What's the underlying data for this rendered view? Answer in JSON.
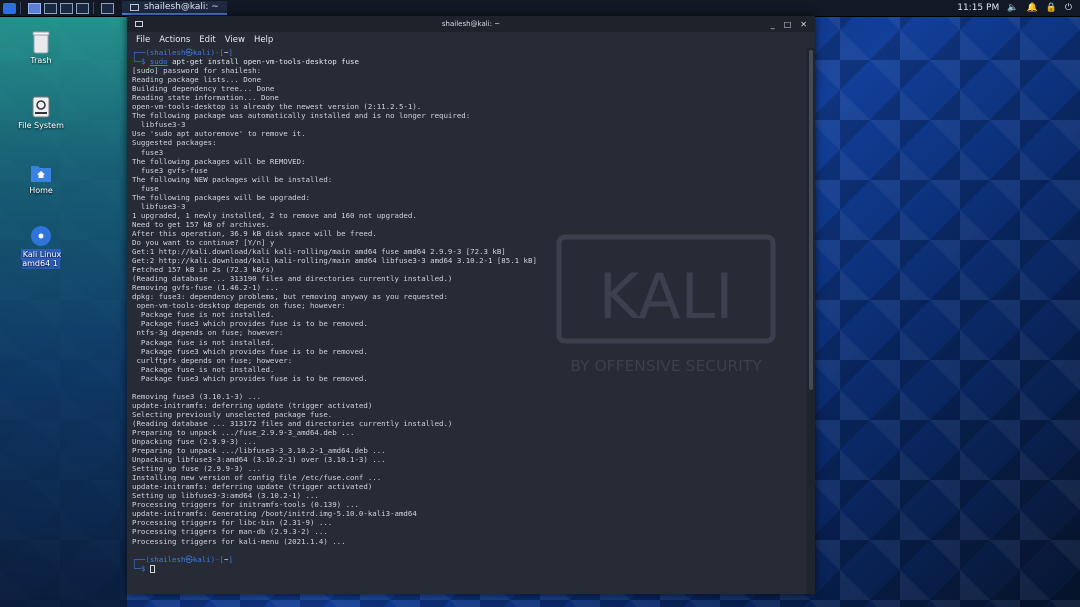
{
  "top_panel": {
    "task_title": "shailesh@kali: ~",
    "time": "11:15 PM"
  },
  "desktop_icons": [
    {
      "label": "Trash"
    },
    {
      "label": "File System"
    },
    {
      "label": "Home"
    },
    {
      "label": "Kali Linux amd64 1"
    }
  ],
  "window": {
    "title": "shailesh@kali: ~",
    "controls": [
      "_",
      "□",
      "✕"
    ],
    "menu": [
      "File",
      "Actions",
      "Edit",
      "View",
      "Help"
    ]
  },
  "terminal": {
    "prompt_user": "shailesh",
    "prompt_host": "kali",
    "prompt_dir": "~",
    "command_sudo": "sudo",
    "command_rest": " apt-get install open-vm-tools-desktop fuse",
    "output": [
      "[sudo] password for shailesh:",
      "Reading package lists... Done",
      "Building dependency tree... Done",
      "Reading state information... Done",
      "open-vm-tools-desktop is already the newest version (2:11.2.5-1).",
      "The following package was automatically installed and is no longer required:",
      "  libfuse3-3",
      "Use 'sudo apt autoremove' to remove it.",
      "Suggested packages:",
      "  fuse3",
      "The following packages will be REMOVED:",
      "  fuse3 gvfs-fuse",
      "The following NEW packages will be installed:",
      "  fuse",
      "The following packages will be upgraded:",
      "  libfuse3-3",
      "1 upgraded, 1 newly installed, 2 to remove and 160 not upgraded.",
      "Need to get 157 kB of archives.",
      "After this operation, 36.9 kB disk space will be freed.",
      "Do you want to continue? [Y/n] y",
      "Get:1 http://kali.download/kali kali-rolling/main amd64 fuse amd64 2.9.9-3 [72.3 kB]",
      "Get:2 http://kali.download/kali kali-rolling/main amd64 libfuse3-3 amd64 3.10.2-1 [85.1 kB]",
      "Fetched 157 kB in 2s (72.3 kB/s)",
      "(Reading database ... 313190 files and directories currently installed.)",
      "Removing gvfs-fuse (1.46.2-1) ...",
      "dpkg: fuse3: dependency problems, but removing anyway as you requested:",
      " open-vm-tools-desktop depends on fuse; however:",
      "  Package fuse is not installed.",
      "  Package fuse3 which provides fuse is to be removed.",
      " ntfs-3g depends on fuse; however:",
      "  Package fuse is not installed.",
      "  Package fuse3 which provides fuse is to be removed.",
      " curlftpfs depends on fuse; however:",
      "  Package fuse is not installed.",
      "  Package fuse3 which provides fuse is to be removed.",
      "",
      "Removing fuse3 (3.10.1-3) ...",
      "update-initramfs: deferring update (trigger activated)",
      "Selecting previously unselected package fuse.",
      "(Reading database ... 313172 files and directories currently installed.)",
      "Preparing to unpack .../fuse_2.9.9-3_amd64.deb ...",
      "Unpacking fuse (2.9.9-3) ...",
      "Preparing to unpack .../libfuse3-3_3.10.2-1_amd64.deb ...",
      "Unpacking libfuse3-3:amd64 (3.10.2-1) over (3.10.1-3) ...",
      "Setting up fuse (2.9.9-3) ...",
      "Installing new version of config file /etc/fuse.conf ...",
      "update-initramfs: deferring update (trigger activated)",
      "Setting up libfuse3-3:amd64 (3.10.2-1) ...",
      "Processing triggers for initramfs-tools (0.139) ...",
      "update-initramfs: Generating /boot/initrd.img-5.10.0-kali3-amd64",
      "Processing triggers for libc-bin (2.31-9) ...",
      "Processing triggers for man-db (2.9.3-2) ...",
      "Processing triggers for kali-menu (2021.1.4) ..."
    ]
  },
  "watermark": {
    "brand": "KALI",
    "tagline": "BY OFFENSIVE SECURITY"
  },
  "colors": {
    "prompt": "#3f7be6",
    "terminal_bg": "#262b36",
    "terminal_text": "#cfd4dc"
  }
}
